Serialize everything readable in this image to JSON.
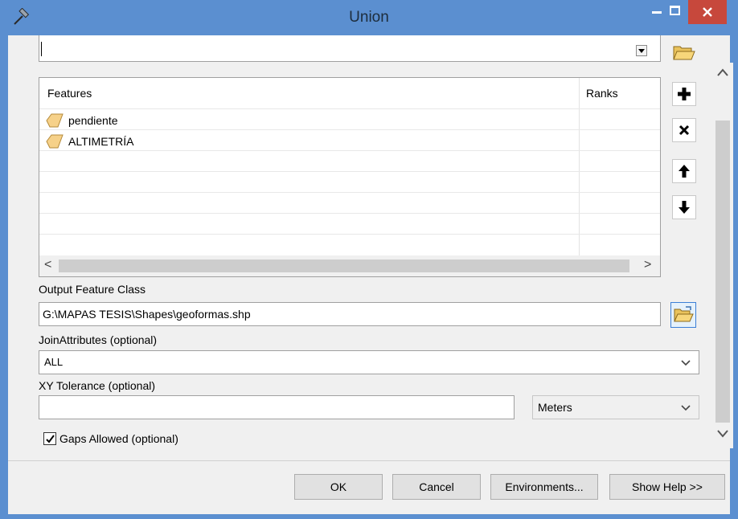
{
  "window": {
    "title": "Union",
    "minimize_glyph": "–",
    "maximize_glyph": "☐",
    "close_glyph": "✕"
  },
  "input_features": {
    "columns": [
      "Features",
      "Ranks"
    ],
    "rows": [
      {
        "name": "pendiente",
        "icon": "polygon-layer-icon"
      },
      {
        "name": "ALTIMETRÍA",
        "icon": "polygon-layer-icon"
      }
    ]
  },
  "side_buttons": {
    "add": "+",
    "remove": "×",
    "up": "⬆",
    "down": "⬇"
  },
  "output": {
    "label": "Output Feature Class",
    "value": "G:\\MAPAS TESIS\\Shapes\\geoformas.shp"
  },
  "join_attributes": {
    "label": "JoinAttributes (optional)",
    "value": "ALL"
  },
  "xy_tolerance": {
    "label": "XY Tolerance (optional)",
    "value": "",
    "units": "Meters"
  },
  "gaps_allowed": {
    "label": "Gaps Allowed (optional)",
    "checked": true
  },
  "footer": {
    "ok": "OK",
    "cancel": "Cancel",
    "environments": "Environments...",
    "show_help": "Show Help >>"
  },
  "colors": {
    "titlebar": "#5b8fd0",
    "close_button": "#c7483c",
    "client_bg": "#f0f0f0"
  }
}
